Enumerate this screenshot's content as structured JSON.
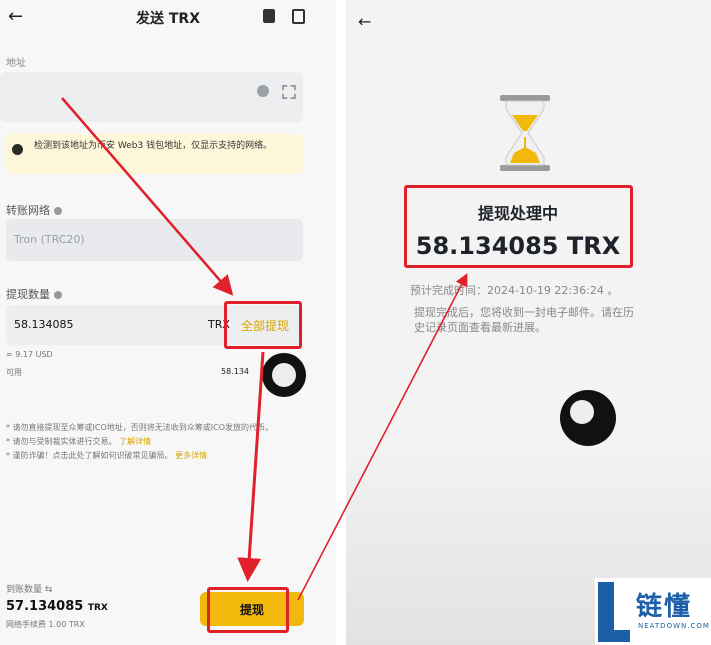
{
  "left_screen": {
    "title": "发送 TRX",
    "back_icon": "back-arrow-icon",
    "address_label": "地址",
    "warning_text": "检测到该地址为币安 Web3 钱包地址，仅显示支持的网络。",
    "network_label": "转账网络",
    "network_value": "Tron (TRC20)",
    "amount_label": "提现数量",
    "amount_value": "58.134085",
    "amount_unit": "TRX",
    "max_label": "全部提现",
    "usd_estimate": "≈ 9.17 USD",
    "available_label": "可用",
    "available_value": "58.134",
    "notes": [
      "* 请勿直接提现至众筹或ICO地址，否则将无法收到众筹或ICO发放的代币。",
      "* 请勿与受制裁实体进行交易。",
      "* 谨防诈骗！点击此处了解如何识破常见骗局。"
    ],
    "note_links": [
      "了解详情",
      "更多详情"
    ],
    "receive_label": "到账数量 ⇆",
    "receive_value": "57.134085",
    "receive_unit": "TRX",
    "fee_text": "网络手续费 1.00 TRX",
    "withdraw_button": "提现"
  },
  "right_screen": {
    "back_icon": "back-arrow-icon",
    "status_icon": "hourglass-icon",
    "status_title": "提现处理中",
    "status_amount": "58.134085 TRX",
    "eta_text": "预计完成时间：2024-10-19 22:36:24 。",
    "description": "提现完成后，您将收到一封电子邮件。请在历史记录页面查看最新进展。"
  },
  "watermark": {
    "text": "链懂",
    "sub": "NEATDOWN.COM"
  },
  "colors": {
    "accent_yellow": "#f0b90b",
    "annotation_red": "#e0202a",
    "warning_bg": "#fdf6d8"
  }
}
